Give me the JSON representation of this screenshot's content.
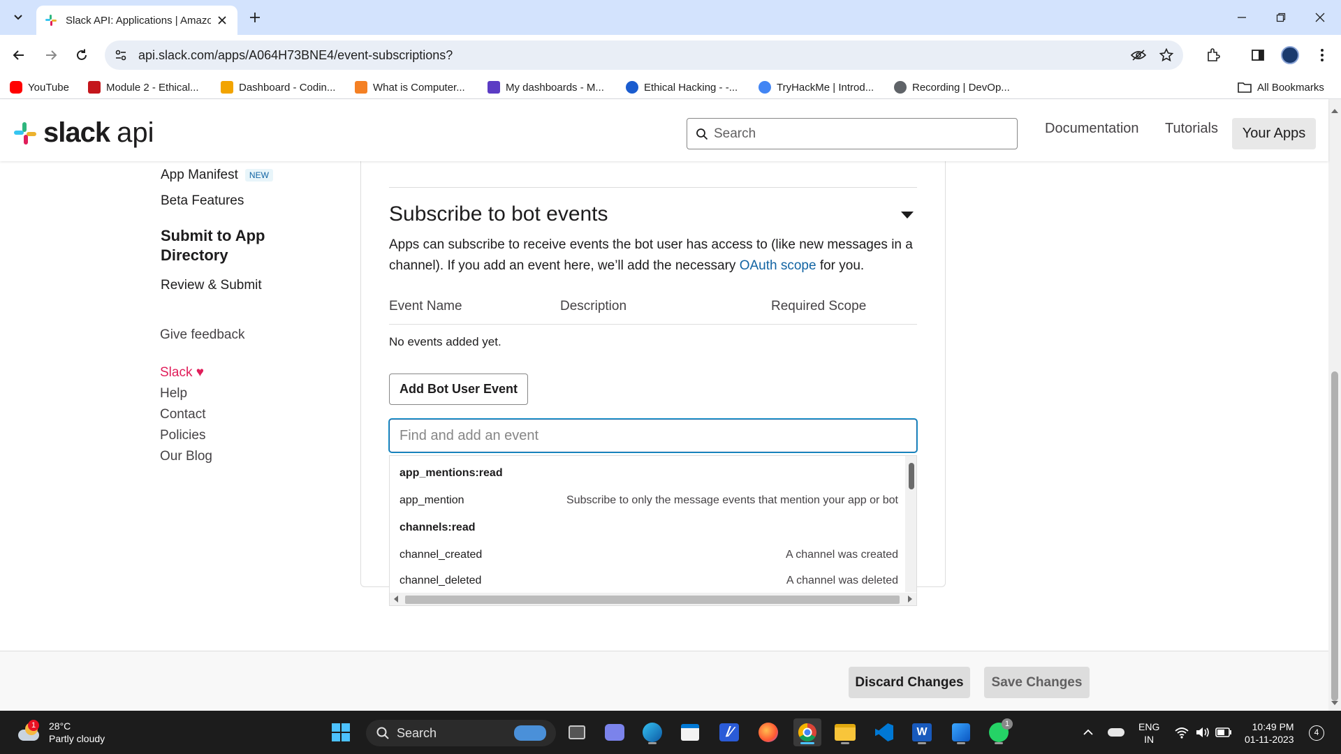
{
  "browser": {
    "tab_title": "Slack API: Applications | Amazon",
    "url": "api.slack.com/apps/A064H73BNE4/event-subscriptions?",
    "bookmarks": [
      {
        "label": "YouTube",
        "color": "#ff0000"
      },
      {
        "label": "Module 2 - Ethical...",
        "color": "#c4161c"
      },
      {
        "label": "Dashboard - Codin...",
        "color": "#f2a400"
      },
      {
        "label": "What is Computer...",
        "color": "#f48024"
      },
      {
        "label": "My dashboards - M...",
        "color": "#5b3cc4"
      },
      {
        "label": "Ethical Hacking - -...",
        "color": "#1a5ccf"
      },
      {
        "label": "TryHackMe | Introd...",
        "color": "#4285f4"
      },
      {
        "label": "Recording | DevOp...",
        "color": "#5f6368"
      }
    ],
    "all_bookmarks": "All Bookmarks"
  },
  "header": {
    "logo_word": "slack",
    "logo_api": "api",
    "search_placeholder": "Search",
    "nav": [
      "Documentation",
      "Tutorials",
      "Your Apps"
    ]
  },
  "sidebar": {
    "app_manifest": "App Manifest",
    "new_badge": "NEW",
    "beta_features": "Beta Features",
    "submit_heading": "Submit to App Directory",
    "review_submit": "Review & Submit",
    "give_feedback": "Give feedback",
    "slack": "Slack",
    "heart": "♥",
    "links": [
      "Help",
      "Contact",
      "Policies",
      "Our Blog"
    ]
  },
  "section": {
    "title": "Subscribe to bot events",
    "desc_before": "Apps can subscribe to receive events the bot user has access to (like new messages in a channel). If you add an event here, we’ll add the necessary ",
    "desc_link": "OAuth scope",
    "desc_after": " for you.",
    "columns": [
      "Event Name",
      "Description",
      "Required Scope"
    ],
    "empty_text": "No events added yet.",
    "add_button": "Add Bot User Event",
    "find_placeholder": "Find and add an event",
    "dropdown": [
      {
        "group": true,
        "name": "app_mentions:read",
        "desc": ""
      },
      {
        "group": false,
        "name": "app_mention",
        "desc": "Subscribe to only the message events that mention your app or bot"
      },
      {
        "group": true,
        "name": "channels:read",
        "desc": ""
      },
      {
        "group": false,
        "name": "channel_created",
        "desc": "A channel was created"
      },
      {
        "group": false,
        "name": "channel_deleted",
        "desc": "A channel was deleted"
      }
    ]
  },
  "actions": {
    "discard": "Discard Changes",
    "save": "Save Changes"
  },
  "taskbar": {
    "temperature": "28°C",
    "weather": "Partly cloudy",
    "weather_badge": "1",
    "search": "Search",
    "whatsapp_badge": "1",
    "lang": "ENG",
    "region": "IN",
    "time": "10:49 PM",
    "date": "01-11-2023",
    "notif_count": "4"
  }
}
